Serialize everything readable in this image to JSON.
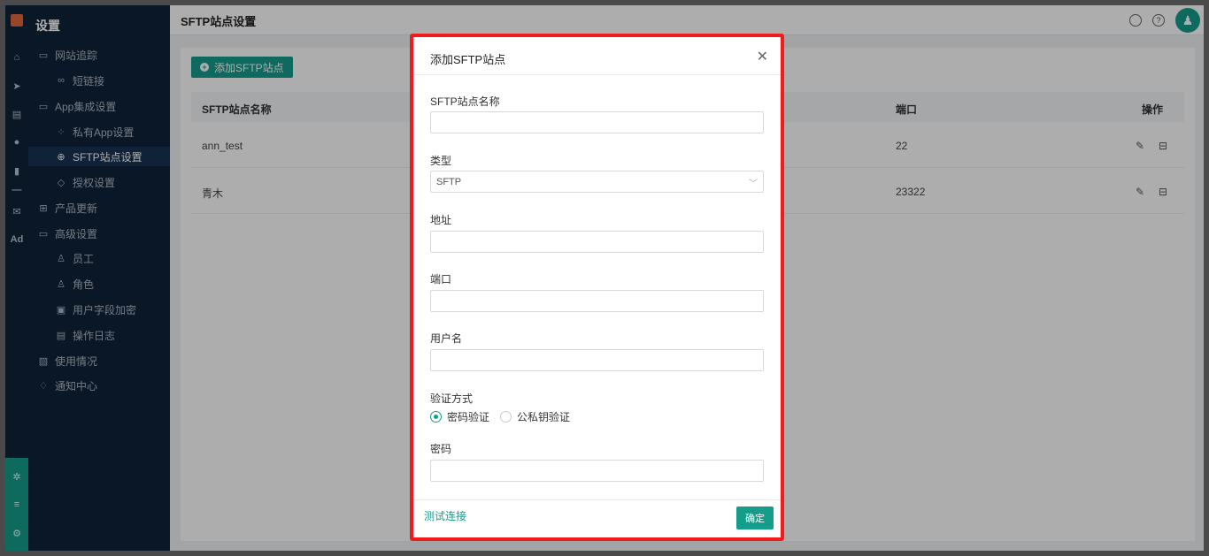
{
  "sidebar": {
    "title": "设置",
    "items": [
      {
        "label": "网站追踪",
        "icon": "folder-icon"
      },
      {
        "label": "短链接",
        "icon": "link-icon"
      },
      {
        "label": "App集成设置",
        "icon": "folder-icon"
      },
      {
        "label": "私有App设置",
        "icon": "apps-icon"
      },
      {
        "label": "SFTP站点设置",
        "icon": "globe-icon"
      },
      {
        "label": "授权设置",
        "icon": "shield-icon"
      },
      {
        "label": "产品更新",
        "icon": "grid-icon"
      },
      {
        "label": "高级设置",
        "icon": "folder-icon"
      },
      {
        "label": "员工",
        "icon": "user-icon"
      },
      {
        "label": "角色",
        "icon": "role-icon"
      },
      {
        "label": "用户字段加密",
        "icon": "encrypt-icon"
      },
      {
        "label": "操作日志",
        "icon": "log-icon"
      },
      {
        "label": "使用情况",
        "icon": "usage-icon"
      },
      {
        "label": "通知中心",
        "icon": "bell-icon"
      }
    ]
  },
  "rail": {
    "ad_label": "Ad"
  },
  "header": {
    "title": "SFTP站点设置"
  },
  "toolbar": {
    "add_label": "添加SFTP站点"
  },
  "table": {
    "columns": [
      "SFTP站点名称",
      "端口",
      "操作"
    ],
    "rows": [
      {
        "name": "ann_test",
        "port": "22"
      },
      {
        "name": "青木",
        "port": "23322"
      }
    ]
  },
  "modal": {
    "title": "添加SFTP站点",
    "fields": {
      "name_label": "SFTP站点名称",
      "type_label": "类型",
      "type_value": "SFTP",
      "address_label": "地址",
      "port_label": "端口",
      "username_label": "用户名",
      "auth_label": "验证方式",
      "auth_options": [
        "密码验证",
        "公私钥验证"
      ],
      "auth_selected": "密码验证",
      "password_label": "密码"
    },
    "test_label": "测试连接",
    "confirm_label": "确定"
  },
  "colors": {
    "accent": "#159d8c",
    "sidebar_bg": "#0f2238",
    "highlight": "#f21b1b"
  }
}
